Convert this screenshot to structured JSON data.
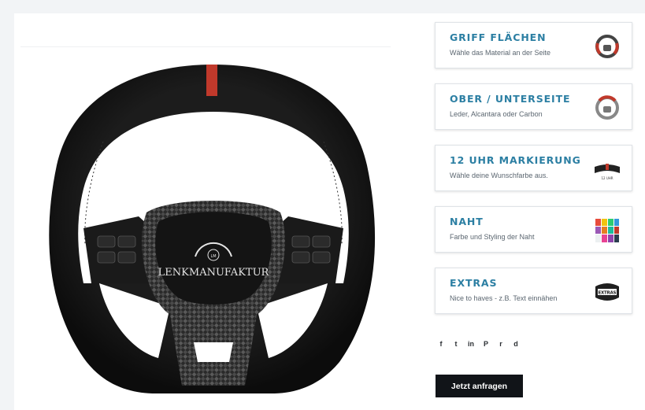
{
  "product": {
    "logo_text": "LENKMANUFAKTUR",
    "logo_badge": "LM",
    "accent_marker_color": "#c0392b"
  },
  "options": [
    {
      "title": "GRIFF FLÄCHEN",
      "subtitle": "Wähle das Material an der Seite",
      "icon": "steering-wheel-red-grip-icon"
    },
    {
      "title": "OBER / UNTERSEITE",
      "subtitle": "Leder, Alcantara oder Carbon",
      "icon": "steering-wheel-top-bottom-icon"
    },
    {
      "title": "12 UHR MARKIERUNG",
      "subtitle": "Wähle deine Wunschfarbe aus.",
      "icon": "twelve-oclock-marker-icon",
      "thumb_caption": "12 UHR"
    },
    {
      "title": "NAHT",
      "subtitle": "Farbe und Styling der Naht",
      "icon": "thread-color-swatches-icon"
    },
    {
      "title": "EXTRAS",
      "subtitle": "Nice to haves - z.B. Text einnähen",
      "icon": "extras-badge-icon",
      "thumb_caption": "EXTRAS"
    }
  ],
  "share": {
    "facebook": "f",
    "twitter": "t",
    "linkedin": "in",
    "pinterest": "P",
    "reddit": "r",
    "document": "d"
  },
  "cta": {
    "label": "Jetzt anfragen"
  },
  "colors": {
    "title_blue": "#2c7fa3",
    "button_bg": "#111418"
  }
}
